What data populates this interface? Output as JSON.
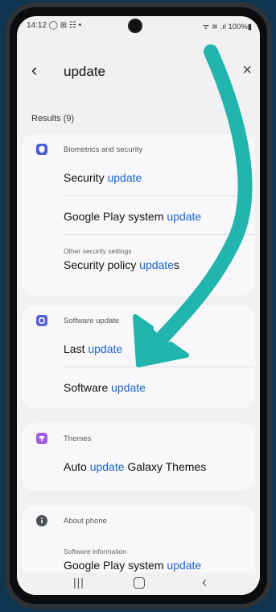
{
  "status_bar": {
    "time_icons": "14:12 ◯ ⊞ ☷ •",
    "right": "ᯤ ≋ .ıl 100%▮"
  },
  "search": {
    "query": "update"
  },
  "results_label": "Results (9)",
  "groups": [
    {
      "category": "Biometrics and security",
      "items": [
        {
          "pre": "Security ",
          "hl": "update",
          "post": ""
        },
        {
          "pre": "Google Play system ",
          "hl": "update",
          "post": ""
        },
        {
          "sub": "Other security settings",
          "pre": "Security policy ",
          "hl": "update",
          "post": "s"
        }
      ]
    },
    {
      "category": "Software update",
      "items": [
        {
          "pre": "Last ",
          "hl": "update",
          "post": ""
        },
        {
          "pre": "Software ",
          "hl": "update",
          "post": ""
        }
      ]
    },
    {
      "category": "Themes",
      "items": [
        {
          "pre": "Auto ",
          "hl": "update",
          "post": " Galaxy Themes"
        }
      ]
    },
    {
      "category": "About phone",
      "items": [
        {
          "sub": "Software information",
          "pre": "Google Play system ",
          "hl": "update",
          "post": ""
        }
      ]
    }
  ],
  "colors": {
    "background": "#0f3550",
    "highlight": "#1d64c8",
    "arrow": "#21b5ad",
    "biometrics_icon": "#4a5bd6",
    "software_icon": "#5660d8",
    "themes_icon": "#a25adf",
    "about_icon": "#4b4f57"
  },
  "icons": {
    "back": "back-arrow-icon",
    "close": "close-icon",
    "biometrics": "shield-icon",
    "software": "software-update-icon",
    "themes": "themes-icon",
    "about": "info-icon"
  }
}
